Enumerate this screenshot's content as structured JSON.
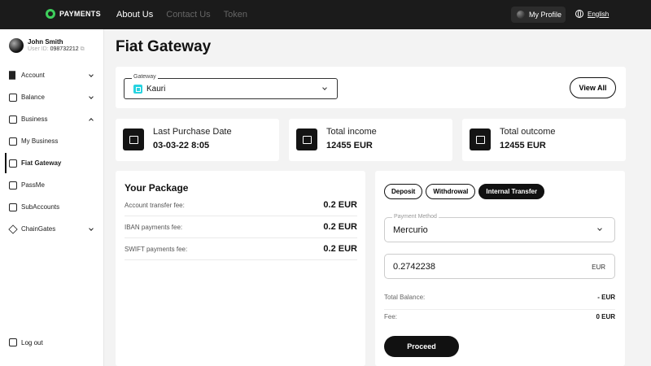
{
  "header": {
    "logo_text": "PAYMENTS",
    "nav": [
      {
        "label": "About Us",
        "active": true
      },
      {
        "label": "Contact Us",
        "active": false
      },
      {
        "label": "Token",
        "active": false
      }
    ],
    "profile_label": "My Profile",
    "language_label": "English"
  },
  "sidebar": {
    "user_name": "John Smith",
    "user_id_label": "User ID:",
    "user_id": "098732212",
    "items": [
      {
        "label": "Account",
        "icon": "grid-icon",
        "expandable": true,
        "expanded": false
      },
      {
        "label": "Balance",
        "icon": "wallet-icon",
        "expandable": true,
        "expanded": false
      },
      {
        "label": "Business",
        "icon": "briefcase-icon",
        "expandable": true,
        "expanded": true
      },
      {
        "label": "My Business",
        "icon": "store-icon",
        "expandable": false
      },
      {
        "label": "Fiat Gateway",
        "icon": "gateway-icon",
        "expandable": false,
        "active": true
      },
      {
        "label": "PassMe",
        "icon": "passme-icon",
        "expandable": false
      },
      {
        "label": "SubAccounts",
        "icon": "subaccounts-icon",
        "expandable": false
      },
      {
        "label": "ChainGates",
        "icon": "chain-icon",
        "expandable": true,
        "expanded": false
      }
    ],
    "logout_label": "Log out"
  },
  "main": {
    "title": "Fiat Gateway",
    "gateway": {
      "label": "Gateway",
      "value": "Kauri",
      "view_all_label": "View All"
    },
    "stats": [
      {
        "label": "Last Purchase Date",
        "value": "03-03-22 8:05",
        "icon": "calendar-icon"
      },
      {
        "label": "Total income",
        "value": "12455 EUR",
        "icon": "income-icon"
      },
      {
        "label": "Total outcome",
        "value": "12455 EUR",
        "icon": "outcome-icon"
      }
    ],
    "package": {
      "title": "Your Package",
      "fees": [
        {
          "label": "Account transfer fee:",
          "value": "0.2 EUR"
        },
        {
          "label": "IBAN payments fee:",
          "value": "0.2 EUR"
        },
        {
          "label": "SWIFT payments fee:",
          "value": "0.2 EUR"
        }
      ]
    },
    "transfer": {
      "tabs": [
        {
          "label": "Deposit",
          "active": false
        },
        {
          "label": "Withdrowal",
          "active": false
        },
        {
          "label": "Internal Transfer",
          "active": true
        }
      ],
      "payment_method_label": "Payment Method",
      "payment_method_value": "Mercurio",
      "amount_value": "0.2742238",
      "amount_unit": "EUR",
      "total_balance_label": "Total Balance:",
      "total_balance_value": "- EUR",
      "fee_label": "Fee:",
      "fee_value": "0 EUR",
      "proceed_label": "Proceed"
    }
  },
  "colors": {
    "topbar": "#1b1b1b",
    "accent_green": "#3ecf5c",
    "kauri_cyan": "#27d3e0",
    "dark": "#111111"
  }
}
